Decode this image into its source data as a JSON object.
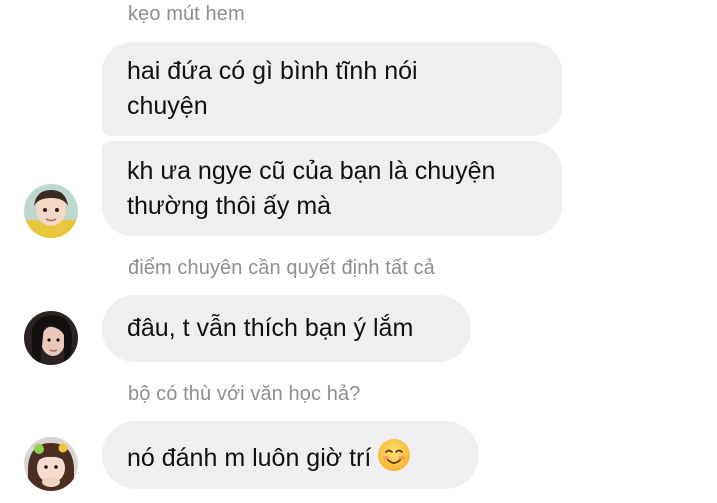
{
  "messages": [
    {
      "sender": "kẹo mút hem",
      "lines": [
        "hai đứa có gì bình tĩnh nói",
        "chuyện"
      ]
    },
    {
      "lines": [
        "kh ưa ngye cũ của bạn là chuyện",
        "thường thôi ấy mà"
      ]
    },
    {
      "sender": "điểm chuyên cần quyết định tất cả",
      "lines": [
        "đâu, t vẫn thích bạn ý lắm"
      ]
    },
    {
      "sender": "bộ có thù với văn học hả?",
      "lines": [
        "nó đánh m luôn giờ trí"
      ]
    }
  ],
  "emoji": "smiling-face-emoji",
  "colors": {
    "bubble": "#efeff1",
    "sender_text": "#8e8e93",
    "message_text": "#111111"
  }
}
